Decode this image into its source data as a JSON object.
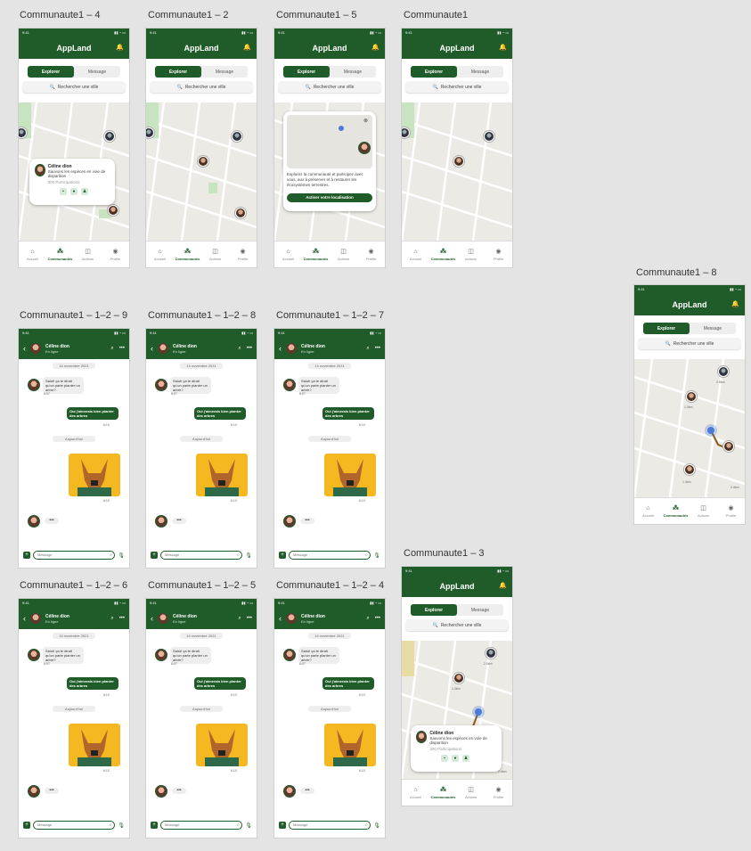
{
  "colors": {
    "brand": "#1f5c2a",
    "bg": "#e4e4e4",
    "accent_yellow": "#f6b820"
  },
  "app": {
    "name": "AppLand",
    "time": "9:41",
    "seg_explore": "Explorer",
    "seg_message": "Message",
    "search_placeholder": "Rechercher une ville",
    "tabs": [
      "Accueil",
      "Communautés",
      "Actions",
      "Profile"
    ]
  },
  "labels": {
    "c4": "Communaute1 – 4",
    "c2": "Communaute1 – 2",
    "c5": "Communaute1 – 5",
    "c1": "Communaute1",
    "c8": "Communaute1 – 8",
    "c129": "Communaute1 – 1–2 – 9",
    "c128": "Communaute1 – 1–2 – 8",
    "c127": "Communaute1 – 1–2 – 7",
    "c126": "Communaute1 – 1–2 – 6",
    "c125": "Communaute1 – 1–2 – 5",
    "c124": "Communaute1 – 1–2 – 4",
    "c3": "Communaute1 – 3"
  },
  "card": {
    "name": "Céline dion",
    "desc": "Sauvons les espèces en voie de disparition",
    "participants": "300 Participations"
  },
  "location_card": {
    "text": "Explorez la communauté et participez avec vous, aux à préserver et à restaurer les écosystèmes terrestres.",
    "button": "Activer votre localisation"
  },
  "distances": [
    "2.5km",
    "1.3km",
    "1.4km",
    "2.4km"
  ],
  "chat": {
    "contact": "Céline dion",
    "status": "En ligne",
    "date": "14 novembre 2021",
    "msg_in": "Salut! ça te dirait qu'on parte planter un arbre?",
    "time_in": "6:07",
    "msg_out": "Oui j'aimerais bien planter des arbres",
    "time_out": "6:10",
    "today": "Aujourd'hui",
    "img_time": "6:10",
    "input_placeholder": "Message"
  }
}
